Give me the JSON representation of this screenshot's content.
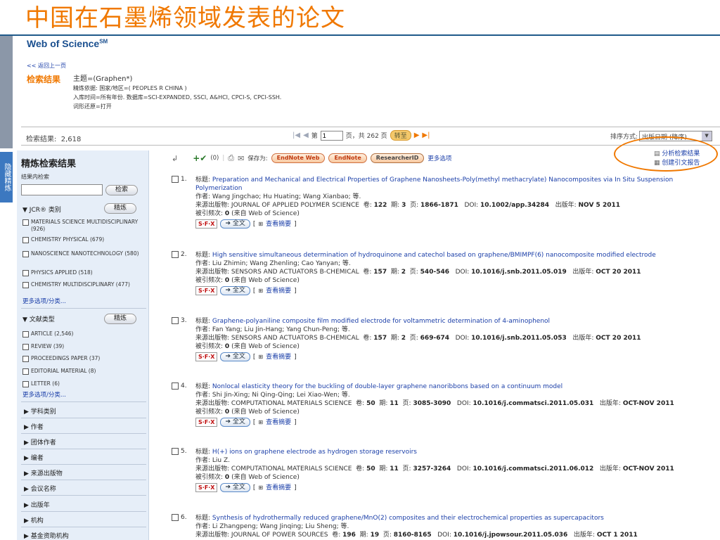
{
  "slide_title": "中国在石墨烯领域发表的论文",
  "wos": {
    "logo": "Web of Science",
    "logo_sup": "SM"
  },
  "back_link": "<< 返回上一页",
  "search_summary": {
    "label": "检索结果",
    "topic": "主题=(Graphen*)",
    "refine": "精炼依据: 国家/地区=( PEOPLES R CHINA )",
    "timespan": "入库时间=所有年份. 数据库=SCI-EXPANDED, SSCI, A&HCI, CPCI-S, CPCI-SSH.",
    "lemma": "词形还原=打开"
  },
  "results_count": {
    "label": "检索结果:",
    "value": "2,618"
  },
  "pager": {
    "page_label": "第",
    "page_value": "1",
    "total_text": "页，共 262 页",
    "go": "转至"
  },
  "sort": {
    "label": "排序方式:",
    "value": "出版日期 (降序)"
  },
  "side_tab": "隐藏精炼",
  "sidebar": {
    "title": "精炼检索结果",
    "within_label": "结果内检索",
    "search_btn": "检索",
    "refine_btn": "精炼",
    "jcr": {
      "heading": "JCR® 类别",
      "items": [
        "MATERIALS SCIENCE MULTIDISCIPLINARY (926)",
        "CHEMISTRY PHYSICAL (679)",
        "NANOSCIENCE NANOTECHNOLOGY (580)",
        "PHYSICS APPLIED (518)",
        "CHEMISTRY MULTIDISCIPLINARY (477)"
      ],
      "more": "更多选项/分类..."
    },
    "doctype": {
      "heading": "文献类型",
      "items": [
        "ARTICLE (2,546)",
        "REVIEW (39)",
        "PROCEEDINGS PAPER (37)",
        "EDITORIAL MATERIAL (8)",
        "LETTER (6)"
      ],
      "more": "更多选项/分类..."
    },
    "collapsed": [
      "学科类别",
      "作者",
      "团体作者",
      "编者",
      "来源出版物",
      "会议名称",
      "出版年",
      "机构",
      "基金资助机构"
    ]
  },
  "toolbar": {
    "marked": "(0)",
    "save_as": "保存为:",
    "endnote_web": "EndNote Web",
    "endnote": "EndNote",
    "researcherid": "ResearcherID",
    "more": "更多选项"
  },
  "analysis": {
    "analyze": "分析检索结果",
    "citation": "创建引文报告"
  },
  "labels": {
    "title": "标题:",
    "author": "作者:",
    "source": "来源出版物:",
    "vol": "卷:",
    "issue": "期:",
    "pages": "页:",
    "doi": "DOI:",
    "pubdate": "出版年:",
    "cited": "被引频次:",
    "cited_suffix": "(来自 Web of Science)",
    "sfx": "S·F·X",
    "fulltext": "全文",
    "abstract": "查看摘要"
  },
  "records": [
    {
      "n": "1.",
      "title": "Preparation and Mechanical and Electrical Properties of Graphene Nanosheets-Poly(methyl methacrylate) Nanocomposites via In Situ Suspension Polymerization",
      "authors": "Wang Jingchao; Hu Huating; Wang Xianbao; 等.",
      "source": "JOURNAL OF APPLIED POLYMER SCIENCE",
      "vol": "122",
      "issue": "3",
      "pages": "1866-1871",
      "doi": "10.1002/app.34284",
      "date": "NOV 5 2011",
      "cited": "0"
    },
    {
      "n": "2.",
      "title": "High sensitive simultaneous determination of hydroquinone and catechol based on graphene/BMIMPF(6) nanocomposite modified electrode",
      "authors": "Liu Zhimin; Wang Zhenling; Cao Yanyan; 等.",
      "source": "SENSORS AND ACTUATORS B-CHEMICAL",
      "vol": "157",
      "issue": "2",
      "pages": "540-546",
      "doi": "10.1016/j.snb.2011.05.019",
      "date": "OCT 20 2011",
      "cited": "0"
    },
    {
      "n": "3.",
      "title": "Graphene-polyaniline composite film modified electrode for voltammetric determination of 4-aminophenol",
      "authors": "Fan Yang; Liu Jin-Hang; Yang Chun-Peng; 等.",
      "source": "SENSORS AND ACTUATORS B-CHEMICAL",
      "vol": "157",
      "issue": "2",
      "pages": "669-674",
      "doi": "10.1016/j.snb.2011.05.053",
      "date": "OCT 20 2011",
      "cited": "0"
    },
    {
      "n": "4.",
      "title": "Nonlocal elasticity theory for the buckling of double-layer graphene nanoribbons based on a continuum model",
      "authors": "Shi Jin-Xing; Ni Qing-Qing; Lei Xiao-Wen; 等.",
      "source": "COMPUTATIONAL MATERIALS SCIENCE",
      "vol": "50",
      "issue": "11",
      "pages": "3085-3090",
      "doi": "10.1016/j.commatsci.2011.05.031",
      "date": "OCT-NOV 2011",
      "cited": "0"
    },
    {
      "n": "5.",
      "title": "H(+) ions on graphene electrode as hydrogen storage reservoirs",
      "authors": "Liu Z.",
      "source": "COMPUTATIONAL MATERIALS SCIENCE",
      "vol": "50",
      "issue": "11",
      "pages": "3257-3264",
      "doi": "10.1016/j.commatsci.2011.06.012",
      "date": "OCT-NOV 2011",
      "cited": "0"
    },
    {
      "n": "6.",
      "title": "Synthesis of hydrothermally reduced graphene/MnO(2) composites and their electrochemical properties as supercapacitors",
      "authors": "Li Zhangpeng; Wang Jinqing; Liu Sheng; 等.",
      "source": "JOURNAL OF POWER SOURCES",
      "vol": "196",
      "issue": "19",
      "pages": "8160-8165",
      "doi": "10.1016/j.jpowsour.2011.05.036",
      "date": "OCT 1 2011",
      "cited": ""
    }
  ],
  "colors": {
    "accent": "#f07800",
    "link": "#1a3ea8",
    "sidebar": "#e6eef8"
  }
}
